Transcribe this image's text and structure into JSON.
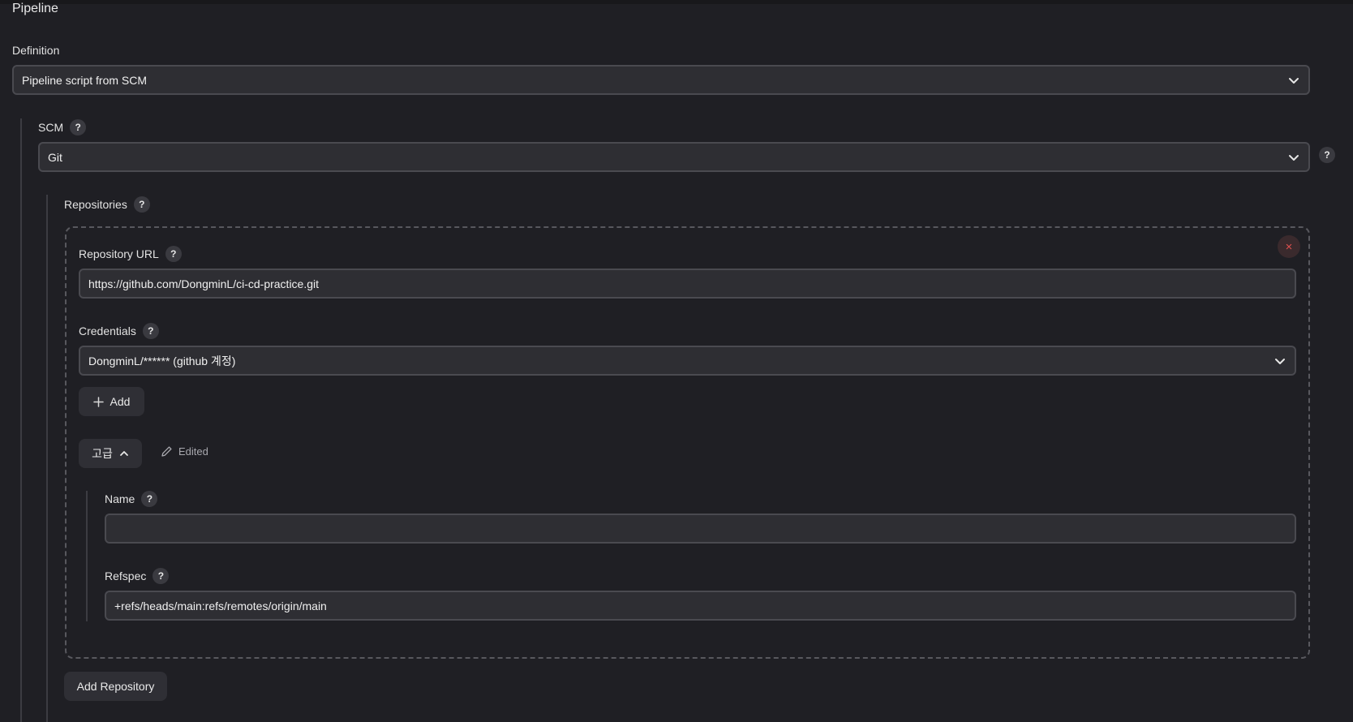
{
  "section": {
    "title": "Pipeline"
  },
  "definition": {
    "label": "Definition",
    "selected": "Pipeline script from SCM"
  },
  "scm": {
    "label": "SCM",
    "help": "?",
    "selected": "Git"
  },
  "repositories": {
    "label": "Repositories",
    "help": "?",
    "url": {
      "label": "Repository URL",
      "help": "?",
      "value": "https://github.com/DongminL/ci-cd-practice.git"
    },
    "credentials": {
      "label": "Credentials",
      "help": "?",
      "selected": "DongminL/****** (github 계정)"
    },
    "add_label": "Add",
    "advanced": {
      "label": "고급",
      "edited_label": "Edited"
    },
    "name": {
      "label": "Name",
      "help": "?",
      "value": ""
    },
    "refspec": {
      "label": "Refspec",
      "help": "?",
      "value": "+refs/heads/main:refs/remotes/origin/main"
    },
    "close_symbol": "×",
    "add_repository_label": "Add Repository"
  },
  "icons": {
    "select_arrow": "chevron-down-icon",
    "remove": "close-icon",
    "add": "plus-icon",
    "collapse": "chevron-up-icon",
    "edited": "pencil-icon",
    "help": "help-icon"
  }
}
